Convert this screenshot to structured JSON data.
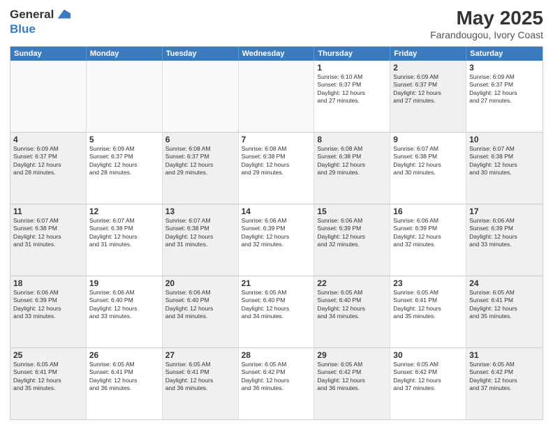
{
  "header": {
    "logo_line1": "General",
    "logo_line2": "Blue",
    "main_title": "May 2025",
    "subtitle": "Farandougou, Ivory Coast"
  },
  "days_of_week": [
    "Sunday",
    "Monday",
    "Tuesday",
    "Wednesday",
    "Thursday",
    "Friday",
    "Saturday"
  ],
  "weeks": [
    [
      {
        "day": "",
        "text": "",
        "shaded": true
      },
      {
        "day": "",
        "text": "",
        "shaded": true
      },
      {
        "day": "",
        "text": "",
        "shaded": true
      },
      {
        "day": "",
        "text": "",
        "shaded": true
      },
      {
        "day": "1",
        "text": "Sunrise: 6:10 AM\nSunset: 6:37 PM\nDaylight: 12 hours\nand 27 minutes.",
        "shaded": false
      },
      {
        "day": "2",
        "text": "Sunrise: 6:09 AM\nSunset: 6:37 PM\nDaylight: 12 hours\nand 27 minutes.",
        "shaded": true
      },
      {
        "day": "3",
        "text": "Sunrise: 6:09 AM\nSunset: 6:37 PM\nDaylight: 12 hours\nand 27 minutes.",
        "shaded": false
      }
    ],
    [
      {
        "day": "4",
        "text": "Sunrise: 6:09 AM\nSunset: 6:37 PM\nDaylight: 12 hours\nand 28 minutes.",
        "shaded": true
      },
      {
        "day": "5",
        "text": "Sunrise: 6:09 AM\nSunset: 6:37 PM\nDaylight: 12 hours\nand 28 minutes.",
        "shaded": false
      },
      {
        "day": "6",
        "text": "Sunrise: 6:08 AM\nSunset: 6:37 PM\nDaylight: 12 hours\nand 29 minutes.",
        "shaded": true
      },
      {
        "day": "7",
        "text": "Sunrise: 6:08 AM\nSunset: 6:38 PM\nDaylight: 12 hours\nand 29 minutes.",
        "shaded": false
      },
      {
        "day": "8",
        "text": "Sunrise: 6:08 AM\nSunset: 6:38 PM\nDaylight: 12 hours\nand 29 minutes.",
        "shaded": true
      },
      {
        "day": "9",
        "text": "Sunrise: 6:07 AM\nSunset: 6:38 PM\nDaylight: 12 hours\nand 30 minutes.",
        "shaded": false
      },
      {
        "day": "10",
        "text": "Sunrise: 6:07 AM\nSunset: 6:38 PM\nDaylight: 12 hours\nand 30 minutes.",
        "shaded": true
      }
    ],
    [
      {
        "day": "11",
        "text": "Sunrise: 6:07 AM\nSunset: 6:38 PM\nDaylight: 12 hours\nand 31 minutes.",
        "shaded": true
      },
      {
        "day": "12",
        "text": "Sunrise: 6:07 AM\nSunset: 6:38 PM\nDaylight: 12 hours\nand 31 minutes.",
        "shaded": false
      },
      {
        "day": "13",
        "text": "Sunrise: 6:07 AM\nSunset: 6:38 PM\nDaylight: 12 hours\nand 31 minutes.",
        "shaded": true
      },
      {
        "day": "14",
        "text": "Sunrise: 6:06 AM\nSunset: 6:39 PM\nDaylight: 12 hours\nand 32 minutes.",
        "shaded": false
      },
      {
        "day": "15",
        "text": "Sunrise: 6:06 AM\nSunset: 6:39 PM\nDaylight: 12 hours\nand 32 minutes.",
        "shaded": true
      },
      {
        "day": "16",
        "text": "Sunrise: 6:06 AM\nSunset: 6:39 PM\nDaylight: 12 hours\nand 32 minutes.",
        "shaded": false
      },
      {
        "day": "17",
        "text": "Sunrise: 6:06 AM\nSunset: 6:39 PM\nDaylight: 12 hours\nand 33 minutes.",
        "shaded": true
      }
    ],
    [
      {
        "day": "18",
        "text": "Sunrise: 6:06 AM\nSunset: 6:39 PM\nDaylight: 12 hours\nand 33 minutes.",
        "shaded": true
      },
      {
        "day": "19",
        "text": "Sunrise: 6:06 AM\nSunset: 6:40 PM\nDaylight: 12 hours\nand 33 minutes.",
        "shaded": false
      },
      {
        "day": "20",
        "text": "Sunrise: 6:06 AM\nSunset: 6:40 PM\nDaylight: 12 hours\nand 34 minutes.",
        "shaded": true
      },
      {
        "day": "21",
        "text": "Sunrise: 6:05 AM\nSunset: 6:40 PM\nDaylight: 12 hours\nand 34 minutes.",
        "shaded": false
      },
      {
        "day": "22",
        "text": "Sunrise: 6:05 AM\nSunset: 6:40 PM\nDaylight: 12 hours\nand 34 minutes.",
        "shaded": true
      },
      {
        "day": "23",
        "text": "Sunrise: 6:05 AM\nSunset: 6:41 PM\nDaylight: 12 hours\nand 35 minutes.",
        "shaded": false
      },
      {
        "day": "24",
        "text": "Sunrise: 6:05 AM\nSunset: 6:41 PM\nDaylight: 12 hours\nand 35 minutes.",
        "shaded": true
      }
    ],
    [
      {
        "day": "25",
        "text": "Sunrise: 6:05 AM\nSunset: 6:41 PM\nDaylight: 12 hours\nand 35 minutes.",
        "shaded": true
      },
      {
        "day": "26",
        "text": "Sunrise: 6:05 AM\nSunset: 6:41 PM\nDaylight: 12 hours\nand 36 minutes.",
        "shaded": false
      },
      {
        "day": "27",
        "text": "Sunrise: 6:05 AM\nSunset: 6:41 PM\nDaylight: 12 hours\nand 36 minutes.",
        "shaded": true
      },
      {
        "day": "28",
        "text": "Sunrise: 6:05 AM\nSunset: 6:42 PM\nDaylight: 12 hours\nand 36 minutes.",
        "shaded": false
      },
      {
        "day": "29",
        "text": "Sunrise: 6:05 AM\nSunset: 6:42 PM\nDaylight: 12 hours\nand 36 minutes.",
        "shaded": true
      },
      {
        "day": "30",
        "text": "Sunrise: 6:05 AM\nSunset: 6:42 PM\nDaylight: 12 hours\nand 37 minutes.",
        "shaded": false
      },
      {
        "day": "31",
        "text": "Sunrise: 6:05 AM\nSunset: 6:42 PM\nDaylight: 12 hours\nand 37 minutes.",
        "shaded": true
      }
    ]
  ]
}
